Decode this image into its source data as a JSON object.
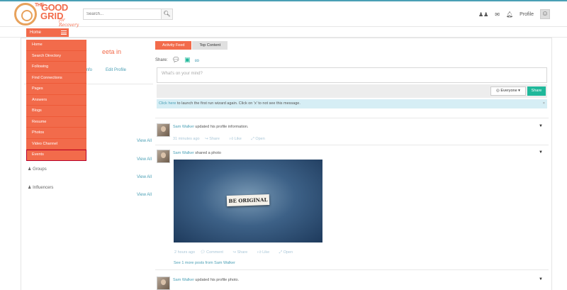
{
  "brand": {
    "line1_small": "THE",
    "line1": "GOOD",
    "line2": "GRID",
    "tagline": "for Recovery"
  },
  "search": {
    "placeholder": "Search...",
    "icon": "search-icon"
  },
  "topnav": {
    "profile_label": "Profile",
    "icons": [
      "users-icon",
      "envelope-icon",
      "bell-icon",
      "user-avatar-icon"
    ]
  },
  "home_button": {
    "label": "Home"
  },
  "menu": {
    "items": [
      "Home",
      "Search Directory",
      "Following",
      "Find Connections",
      "Pages",
      "Answers",
      "Blogs",
      "Resume",
      "Photos",
      "Video Channel",
      "Events"
    ],
    "highlighted": "Events"
  },
  "profile": {
    "name_fragment": "eeta in",
    "info_link": "Info",
    "edit_link": "Edit Profile"
  },
  "left_sections": {
    "view_all": "View All",
    "groups": "Groups",
    "influencers": "Influencers"
  },
  "tabs": [
    {
      "label": "Activity Feed",
      "active": true
    },
    {
      "label": "Top Content",
      "active": false
    }
  ],
  "composer": {
    "share_label": "Share:",
    "placeholder": "What's on your mind?",
    "audience": "Everyone",
    "share_button": "Share"
  },
  "wizard": {
    "link_text": "Click here",
    "text": " to launch the first run wizard again. Click on 'x' to not see this message.",
    "close": "×"
  },
  "feed": [
    {
      "user": "Sam Walker",
      "action": "updated his profile information.",
      "time": "31 minutes ago",
      "actions": [
        "Share",
        "Like",
        "Open"
      ]
    },
    {
      "user": "Sam Walker",
      "action": "shared a photo",
      "photo_text": "BE ORIGINAL",
      "time": "2 hours ago",
      "actions": [
        "Comment",
        "Share",
        "Like",
        "Open"
      ],
      "see_more": "See 1 more posts from Sam Walker"
    },
    {
      "user": "Sam Walker",
      "action": "updated his profile photo."
    }
  ],
  "colors": {
    "accent": "#f26b4b",
    "teal": "#1fb89a",
    "link": "#4a9fb5",
    "info_bg": "#d6eef5"
  }
}
